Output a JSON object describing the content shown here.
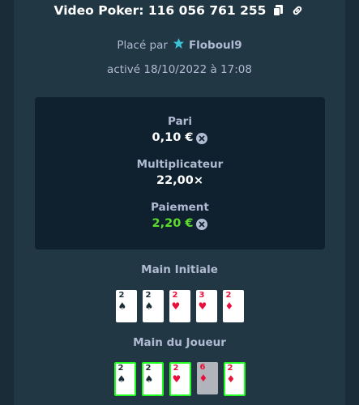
{
  "header": {
    "title": "Video Poker: 116 056 761 255",
    "copy_icon": "copy-icon",
    "link_icon": "link-icon"
  },
  "placed": {
    "prefix": "Placé par",
    "username": "Floboul9",
    "badge_icon": "star-badge-icon"
  },
  "activated": "activé 18/10/2022 à 17:08",
  "stats": {
    "bet_label": "Pari",
    "bet_value": "0,10 €",
    "multiplier_label": "Multiplicateur",
    "multiplier_value": "22,00×",
    "payout_label": "Paiement",
    "payout_value": "2,20 €",
    "currency_icon": "currency-icon"
  },
  "initial_hand": {
    "title": "Main Initiale",
    "cards": [
      {
        "rank": "2",
        "suit": "♠",
        "color": "black"
      },
      {
        "rank": "2",
        "suit": "♠",
        "color": "black"
      },
      {
        "rank": "2",
        "suit": "♥",
        "color": "red"
      },
      {
        "rank": "3",
        "suit": "♥",
        "color": "red"
      },
      {
        "rank": "2",
        "suit": "♦",
        "color": "red"
      }
    ]
  },
  "player_hand": {
    "title": "Main du Joueur",
    "cards": [
      {
        "rank": "2",
        "suit": "♠",
        "color": "black",
        "held": true
      },
      {
        "rank": "2",
        "suit": "♠",
        "color": "black",
        "held": true
      },
      {
        "rank": "2",
        "suit": "♥",
        "color": "red",
        "held": true
      },
      {
        "rank": "6",
        "suit": "♦",
        "color": "red",
        "held": false
      },
      {
        "rank": "2",
        "suit": "♦",
        "color": "red",
        "held": true
      }
    ]
  },
  "colors": {
    "background": "#1a2c38",
    "panel": "#213743",
    "stats_bg": "#0f212e",
    "win_green": "#5ddc2c",
    "held_border": "#1fff20"
  }
}
